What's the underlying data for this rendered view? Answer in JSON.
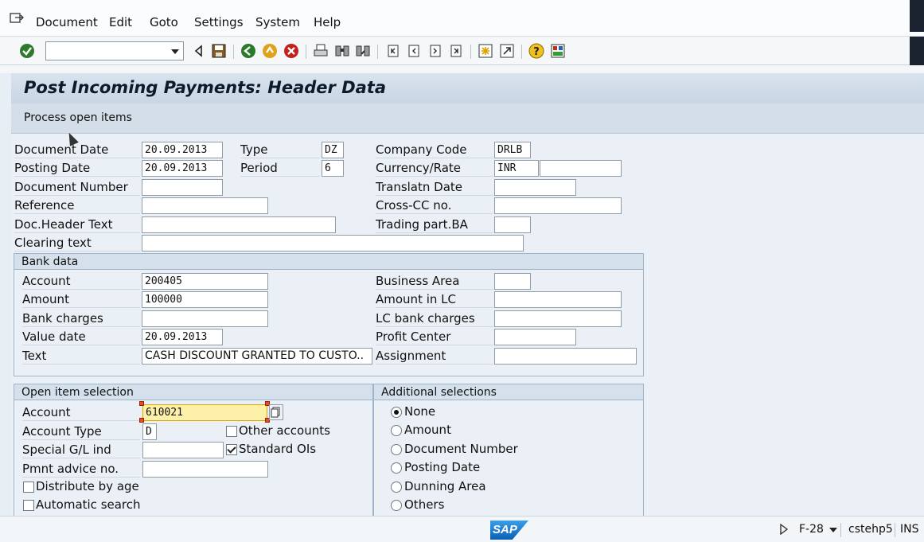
{
  "menu": {
    "items": [
      "Document",
      "Edit",
      "Goto",
      "Settings",
      "System",
      "Help"
    ]
  },
  "toolbar": {
    "command_field_value": "",
    "icons": [
      "enter-icon",
      "back-icon",
      "save-icon",
      "back-green-icon",
      "exit-icon",
      "cancel-icon",
      "print-icon",
      "find-icon",
      "find-next-icon",
      "first-page-icon",
      "prev-page-icon",
      "next-page-icon",
      "last-page-icon",
      "create-session-icon",
      "shortcut-icon",
      "help-icon",
      "layout-icon"
    ]
  },
  "title": "Post Incoming Payments: Header Data",
  "app_toolbar": {
    "process_button": "Process open items"
  },
  "header": {
    "document_date_label": "Document Date",
    "document_date": "20.09.2013",
    "type_label": "Type",
    "type": "DZ",
    "company_code_label": "Company Code",
    "company_code": "DRLB",
    "posting_date_label": "Posting Date",
    "posting_date": "20.09.2013",
    "period_label": "Period",
    "period": "6",
    "currency_label": "Currency/Rate",
    "currency": "INR",
    "rate": "",
    "document_number_label": "Document Number",
    "document_number": "",
    "translatn_date_label": "Translatn Date",
    "translatn_date": "",
    "reference_label": "Reference",
    "reference": "",
    "cross_cc_label": "Cross-CC no.",
    "cross_cc": "",
    "doc_header_text_label": "Doc.Header Text",
    "doc_header_text": "",
    "trading_part_label": "Trading part.BA",
    "trading_part": "",
    "clearing_text_label": "Clearing text",
    "clearing_text": ""
  },
  "bank_data": {
    "title": "Bank data",
    "account_label": "Account",
    "account": "200405",
    "amount_label": "Amount",
    "amount": "100000",
    "bank_charges_label": "Bank charges",
    "bank_charges": "",
    "value_date_label": "Value date",
    "value_date": "20.09.2013",
    "text_label": "Text",
    "text": "CASH DISCOUNT GRANTED TO CUSTO..",
    "business_area_label": "Business Area",
    "business_area": "",
    "amount_lc_label": "Amount in LC",
    "amount_lc": "",
    "lc_bank_charges_label": "LC bank charges",
    "lc_bank_charges": "",
    "profit_center_label": "Profit Center",
    "profit_center": "",
    "assignment_label": "Assignment",
    "assignment": ""
  },
  "open_item_selection": {
    "title": "Open item selection",
    "account_label": "Account",
    "account": "610021",
    "account_type_label": "Account Type",
    "account_type": "D",
    "other_accounts_label": "Other accounts",
    "other_accounts_checked": false,
    "special_gl_label": "Special G/L ind",
    "special_gl": "",
    "standard_ois_label": "Standard OIs",
    "standard_ois_checked": true,
    "pmnt_advice_label": "Pmnt advice no.",
    "pmnt_advice": "",
    "distribute_label": "Distribute by age",
    "distribute_checked": false,
    "auto_search_label": "Automatic search",
    "auto_search_checked": false
  },
  "additional_selections": {
    "title": "Additional selections",
    "options": [
      "None",
      "Amount",
      "Document Number",
      "Posting Date",
      "Dunning Area",
      "Others"
    ],
    "selected": "None"
  },
  "status": {
    "transaction": "F-28",
    "server": "cstehp5",
    "mode": "INS",
    "logo": "SAP"
  }
}
